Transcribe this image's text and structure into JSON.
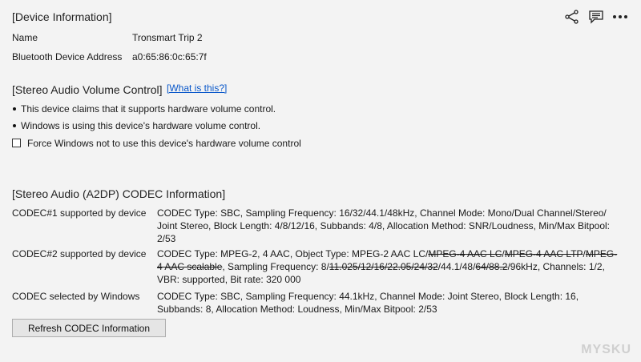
{
  "device_info": {
    "title": "[Device Information]",
    "name_label": "Name",
    "name_value": "Tronsmart Trip 2",
    "address_label": "Bluetooth Device Address",
    "address_value": "a0:65:86:0c:65:7f"
  },
  "toolbar": {
    "share_icon": "share-icon",
    "feedback_icon": "comment-icon",
    "more_icon": "more-icon"
  },
  "volume": {
    "title": "[Stereo Audio Volume Control]",
    "help_link": "[What is this?]",
    "bullet1": "This device claims that it supports hardware volume control.",
    "bullet2": "Windows is using this device's hardware volume control.",
    "checkbox_label": "Force Windows not to use this device's hardware volume control",
    "checkbox_checked": false
  },
  "codec": {
    "title": "[Stereo Audio (A2DP) CODEC Information]",
    "c1_label": "CODEC#1 supported by device",
    "c1_text": "CODEC Type: SBC, Sampling Frequency: 16/32/44.1/48kHz, Channel Mode: Mono/Dual Channel/Stereo/ Joint Stereo, Block Length: 4/8/12/16, Subbands: 4/8, Allocation Method: SNR/Loudness, Min/Max Bitpool: 2/53",
    "c2_label": "CODEC#2 supported by device",
    "c2_parts": {
      "p1": "CODEC Type: MPEG-2, 4 AAC, Object Type: MPEG-2 AAC LC/",
      "s1": "MPEG-4 AAC LC",
      "p2": "/",
      "s2": "MPEG-4 AAC LTP",
      "p3": "/",
      "s3": "MPEG-4 AAC scalable",
      "p4": ", Sampling Frequency: 8/",
      "s4": "11.025/12/16/22.05/24/32",
      "p5": "/44.1/48/",
      "s5": "64/88.2",
      "p6": "/96kHz, Channels: 1/2, VBR: supported, Bit rate: 320 000"
    },
    "c3_label": "CODEC selected by Windows",
    "c3_text": "CODEC Type: SBC, Sampling Frequency: 44.1kHz, Channel Mode: Joint Stereo, Block Length: 16, Subbands: 8, Allocation Method: Loudness, Min/Max Bitpool: 2/53",
    "refresh_button": "Refresh CODEC Information"
  },
  "watermark": "MYSKU"
}
